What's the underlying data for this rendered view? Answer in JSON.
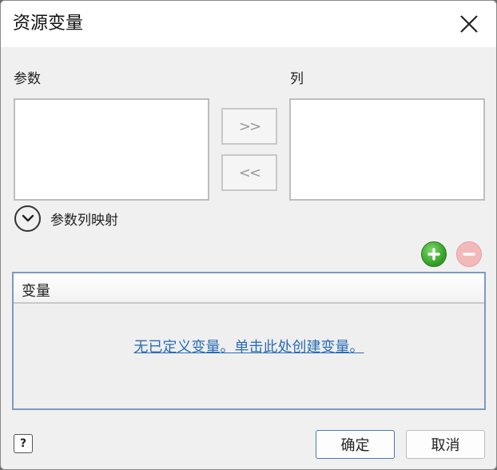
{
  "dialog": {
    "title": "资源变量"
  },
  "params": {
    "label": "参数",
    "items": []
  },
  "columns": {
    "label": "列",
    "items": []
  },
  "move": {
    "add_label": ">>",
    "remove_label": "<<"
  },
  "mapping": {
    "label": "参数列映射"
  },
  "variables": {
    "header": "变量",
    "empty_message": "无已定义变量。单击此处创建变量。"
  },
  "footer": {
    "help_label": "?",
    "ok_label": "确定",
    "cancel_label": "取消"
  },
  "colors": {
    "add": "#2e9a22",
    "remove": "#f3b9b9",
    "link": "#2a6cb5"
  }
}
